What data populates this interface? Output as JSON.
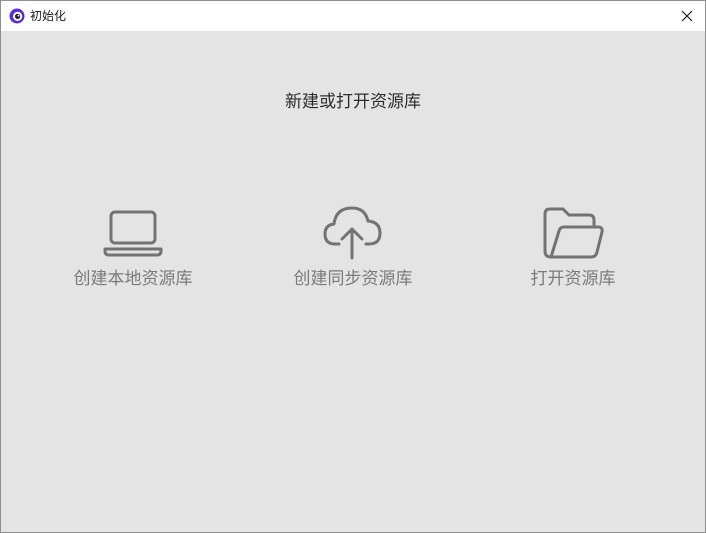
{
  "window": {
    "title": "初始化",
    "icons": {
      "app": "app-logo-icon",
      "close": "close-icon"
    },
    "colors": {
      "background": "#e4e4e4",
      "titlebar": "#ffffff",
      "logo_accent": "#5b2bd6"
    }
  },
  "main": {
    "heading": "新建或打开资源库",
    "options": [
      {
        "label": "创建本地资源库",
        "icon": "laptop-icon"
      },
      {
        "label": "创建同步资源库",
        "icon": "cloud-upload-icon"
      },
      {
        "label": "打开资源库",
        "icon": "folder-open-icon"
      }
    ]
  }
}
